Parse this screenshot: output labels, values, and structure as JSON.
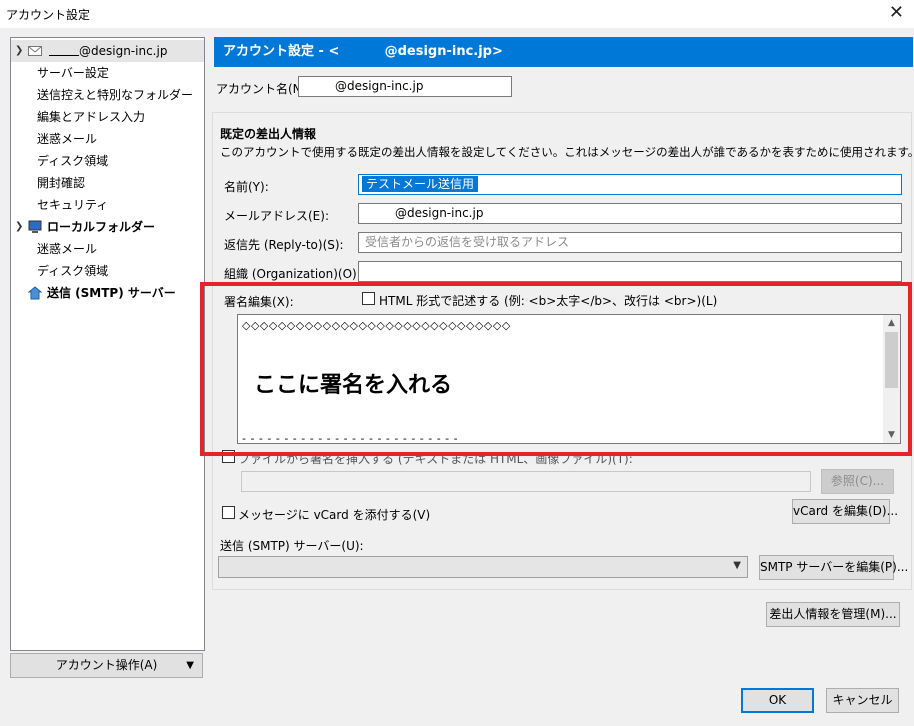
{
  "window": {
    "title": "アカウント設定",
    "close_glyph": "✕"
  },
  "tree": {
    "items": [
      {
        "label": "@design-inc.jp",
        "level": 0,
        "icon": "mail-account-icon",
        "expanded": true,
        "selected": true
      },
      {
        "label": "サーバー設定",
        "level": 1
      },
      {
        "label": "送信控えと特別なフォルダー",
        "level": 1
      },
      {
        "label": "編集とアドレス入力",
        "level": 1
      },
      {
        "label": "迷惑メール",
        "level": 1
      },
      {
        "label": "ディスク領域",
        "level": 1
      },
      {
        "label": "開封確認",
        "level": 1
      },
      {
        "label": "セキュリティ",
        "level": 1
      },
      {
        "label": "ローカルフォルダー",
        "level": 0,
        "icon": "computer-icon",
        "expanded": true,
        "bold": true
      },
      {
        "label": "迷惑メール",
        "level": 1
      },
      {
        "label": "ディスク領域",
        "level": 1
      },
      {
        "label": "送信 (SMTP) サーバー",
        "level": 0,
        "icon": "smtp-server-icon",
        "bold": true
      }
    ],
    "account_ops": "アカウント操作(A)"
  },
  "header": {
    "title": "アカウント設定 - <          @design-inc.jp>"
  },
  "account_name": {
    "label": "アカウント名(N):",
    "value": "@design-inc.jp"
  },
  "identity": {
    "title": "既定の差出人情報",
    "description": "このアカウントで使用する既定の差出人情報を設定してください。これはメッセージの差出人が誰であるかを表すために使用されます。",
    "name_label": "名前(Y):",
    "name_value": "テストメール送信用",
    "email_label": "メールアドレス(E):",
    "email_value": "@design-inc.jp",
    "replyto_label": "返信先 (Reply-to)(S):",
    "replyto_placeholder": "受信者からの返信を受け取るアドレス",
    "org_label": "組織 (Organization)(O):",
    "org_value": ""
  },
  "signature": {
    "label": "署名編集(X):",
    "html_checkbox_label": "HTML 形式で記述する (例: <b>太字</b>、改行は <br>)(L)",
    "html_checked": false,
    "line1": "◇◇◇◇◇◇◇◇◇◇◇◇◇◇◇◇◇◇◇◇◇◇◇◇◇◇◇◇◇◇",
    "body": "ここに署名を入れる",
    "line2": "- - - - - - - - - - - - - - - - - - - - - - - - - -",
    "file_checkbox_label": "ファイルから署名を挿入する (テキストまたは HTML、画像ファイル)(T):",
    "file_checked": false,
    "browse_label": "参照(C)..."
  },
  "vcard": {
    "checkbox_label": "メッセージに vCard を添付する(V)",
    "checked": false,
    "edit_label": "vCard を編集(D)..."
  },
  "smtp": {
    "label": "送信 (SMTP) サーバー(U):",
    "value": "",
    "edit_label": "SMTP サーバーを編集(P)..."
  },
  "buttons": {
    "manage_identities": "差出人情報を管理(M)...",
    "ok": "OK",
    "cancel": "キャンセル"
  },
  "colors": {
    "header_bg": "#0078d7",
    "highlight": "#e3242b",
    "selection": "#0078d7"
  }
}
